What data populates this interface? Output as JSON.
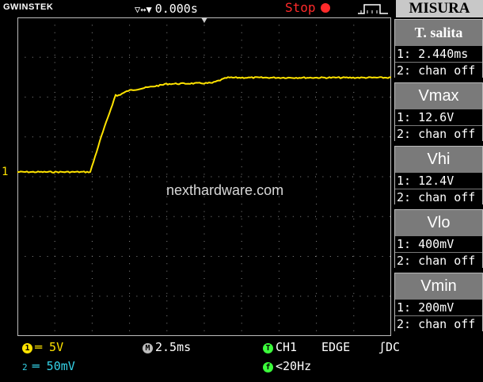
{
  "header": {
    "brand": "GWINSTEK",
    "trigger_arrows": "▽↔▼",
    "trigger_delay": "0.000s",
    "run_state": "Stop",
    "menu_title": "MISURA"
  },
  "measurements": [
    {
      "label": "T. salita",
      "ch1": "1: 2.440ms",
      "ch2": "2: chan off"
    },
    {
      "label": "Vmax",
      "ch1": "1: 12.6V",
      "ch2": "2: chan off"
    },
    {
      "label": "Vhi",
      "ch1": "1: 12.4V",
      "ch2": "2: chan off"
    },
    {
      "label": "Vlo",
      "ch1": "1: 400mV",
      "ch2": "2: chan off"
    },
    {
      "label": "Vmin",
      "ch1": "1: 200mV",
      "ch2": "2: chan off"
    }
  ],
  "status": {
    "ch1_badge": "1",
    "ch1_scale": "═ 5V",
    "ch2_badge": "2",
    "ch2_scale": "═ 50mV",
    "timebase_badge": "M",
    "timebase": "2.5ms",
    "trig_badge": "T",
    "trig_source": "CH1",
    "trig_type": "EDGE",
    "trig_coupling": "ʃDC",
    "freq_badge": "f",
    "frequency": "<20Hz"
  },
  "channel_marker": "1",
  "watermark": "nexthardware.com",
  "colors": {
    "ch1": "#ffe300",
    "ch2": "#35d3e8",
    "grid": "#8a8a8a",
    "stop": "#ff2a2a"
  }
}
